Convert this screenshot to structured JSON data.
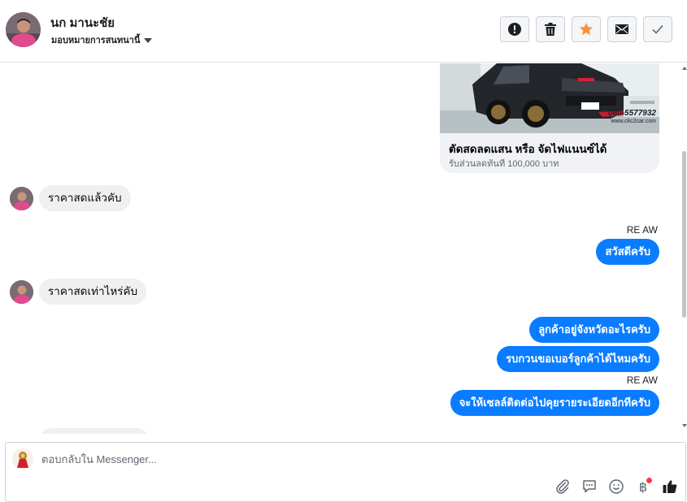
{
  "header": {
    "contact_name": "นก มานะชัย",
    "assign_label": "มอบหมายการสนทนานี้",
    "actions": [
      {
        "name": "mark-spam-button",
        "icon": "exclamation-icon",
        "color": "#1c1e21"
      },
      {
        "name": "delete-button",
        "icon": "trash-icon",
        "color": "#1c1e21"
      },
      {
        "name": "star-button",
        "icon": "star-icon",
        "color": "#f7923b"
      },
      {
        "name": "mark-unread-button",
        "icon": "envelope-icon",
        "color": "#1c1e21"
      },
      {
        "name": "mark-done-button",
        "icon": "check-icon",
        "color": "#606770"
      }
    ]
  },
  "ad_card": {
    "image_watermark": "080-5577932",
    "image_site": "www.ckc2car.com",
    "title": "ตัดสดลดแสน หรือ จัดไฟแนนซ์ได้",
    "subtitle": "รับส่วนลดทันที 100,000 บาท"
  },
  "messages": [
    {
      "direction": "in",
      "text": "ราคาสดแล้วคับ"
    },
    {
      "direction": "out",
      "sender": "RE AW",
      "text": "สวัสดีครับ"
    },
    {
      "direction": "in",
      "text": "ราคาสดเท่าไหร่คับ"
    },
    {
      "direction": "out",
      "text": "ลูกค้าอยู่จังหวัดอะไรครับ"
    },
    {
      "direction": "out",
      "text": "รบกวนขอเบอร์ลูกค้าได้ไหมครับ"
    },
    {
      "direction": "out",
      "sender": "RE AW",
      "text": "จะให้เซลล์ติดต่อไปคุยรายระเอียดอีกทีครับ"
    }
  ],
  "composer": {
    "placeholder": "ตอบกลับใน Messenger...",
    "tools": [
      "paperclip-icon",
      "saved-reply-icon",
      "emoji-icon",
      "baht-payment-icon",
      "thumbs-up-icon"
    ]
  },
  "colors": {
    "outgoing_bubble": "#0a7cff",
    "incoming_bubble": "#f0f0f0",
    "star": "#f7923b"
  }
}
